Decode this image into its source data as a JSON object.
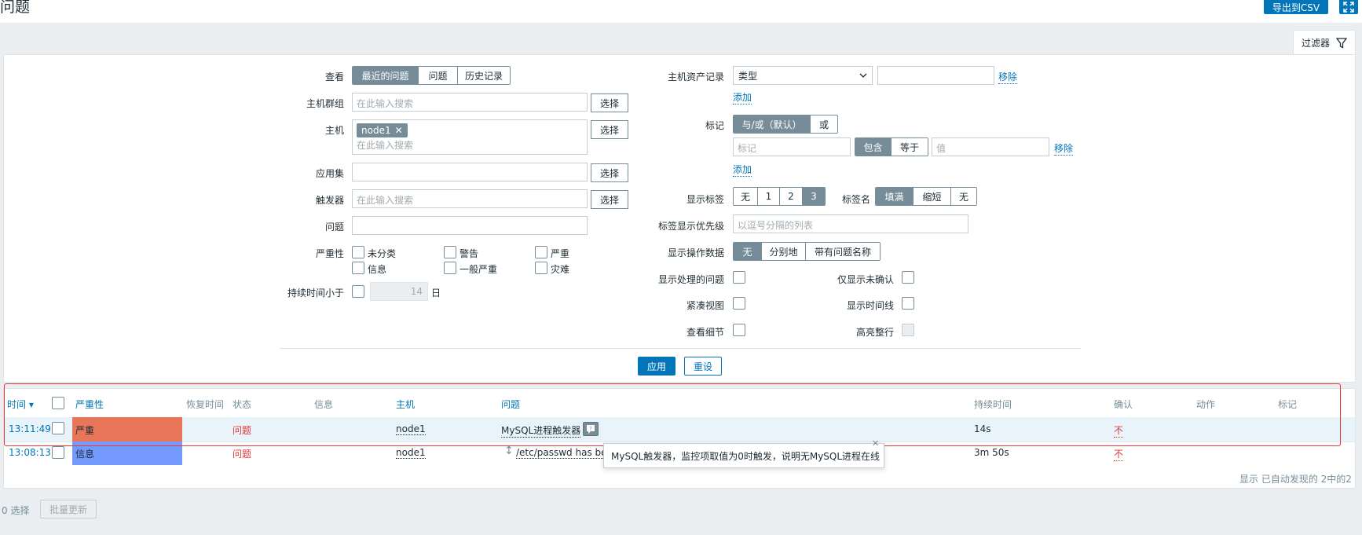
{
  "header": {
    "title": "问题",
    "export_csv": "导出到CSV",
    "fullscreen_icon": "fullscreen-icon"
  },
  "filter_tab": {
    "label": "过滤器",
    "icon": "filter-icon"
  },
  "filter": {
    "view": {
      "label": "查看",
      "options": [
        "最近的问题",
        "问题",
        "历史记录"
      ],
      "selected": "最近的问题"
    },
    "host_groups": {
      "label": "主机群组",
      "placeholder": "在此输入搜索",
      "select": "选择"
    },
    "hosts": {
      "label": "主机",
      "chip": "node1",
      "placeholder": "在此输入搜索",
      "select": "选择"
    },
    "application": {
      "label": "应用集",
      "value": "",
      "select": "选择"
    },
    "triggers": {
      "label": "触发器",
      "placeholder": "在此输入搜索",
      "select": "选择"
    },
    "problem": {
      "label": "问题",
      "value": ""
    },
    "severity": {
      "label": "严重性",
      "items": [
        "未分类",
        "警告",
        "严重",
        "信息",
        "一般严重",
        "灾难"
      ]
    },
    "age": {
      "label": "持续时间小于",
      "value": "14",
      "unit": "日"
    },
    "inventory": {
      "label": "主机资产记录",
      "selected": "类型",
      "value": "",
      "remove": "移除",
      "add": "添加"
    },
    "tags": {
      "label": "标记",
      "options": [
        "与/或（默认）",
        "或"
      ],
      "selected": "与/或（默认）",
      "tag_placeholder": "标记",
      "ops": [
        "包含",
        "等于"
      ],
      "op_selected": "包含",
      "value_placeholder": "值",
      "remove": "移除",
      "add": "添加"
    },
    "show_tags": {
      "label": "显示标签",
      "options": [
        "无",
        "1",
        "2",
        "3"
      ],
      "selected": "3",
      "name_label": "标签名",
      "name_options": [
        "填满",
        "缩短",
        "无"
      ],
      "name_selected": "填满"
    },
    "tag_priority": {
      "label": "标签显示优先级",
      "placeholder": "以逗号分隔的列表"
    },
    "show_opdata": {
      "label": "显示操作数据",
      "options": [
        "无",
        "分别地",
        "带有问题名称"
      ],
      "selected": "无"
    },
    "checks": {
      "suppressed": "显示处理的问题",
      "unacked": "仅显示未确认",
      "compact": "紧凑视图",
      "timeline": "显示时间线",
      "details": "查看细节",
      "highlight": "高亮整行"
    },
    "apply": "应用",
    "reset": "重设"
  },
  "table": {
    "columns": [
      "时间 ▾",
      "严重性",
      "恢复时间",
      "状态",
      "信息",
      "主机",
      "问题",
      "持续时间",
      "确认",
      "动作",
      "标记"
    ],
    "rows": [
      {
        "time": "13:11:49",
        "severity": "严重",
        "recovery": "",
        "status": "问题",
        "info": "",
        "host": "node1",
        "problem": "MySQL进程触发器",
        "duration": "14s",
        "ack": "不",
        "actions": "",
        "tags": ""
      },
      {
        "time": "13:08:13",
        "severity": "信息",
        "recovery": "",
        "status": "问题",
        "info": "",
        "host": "node1",
        "problem": "/etc/passwd has bee",
        "duration": "3m 50s",
        "ack": "不",
        "actions": "",
        "tags": ""
      }
    ],
    "tooltip": "MySQL触发器，监控项取值为0时触发，说明无MySQL进程在线",
    "footer": "显示 已自动发现的 2中的2"
  },
  "bottom": {
    "selected": "0 选择",
    "mass_update": "批量更新"
  },
  "colors": {
    "accent": "#0275b8",
    "high": "#e97659",
    "info": "#7499ff",
    "problem": "#e33734"
  }
}
